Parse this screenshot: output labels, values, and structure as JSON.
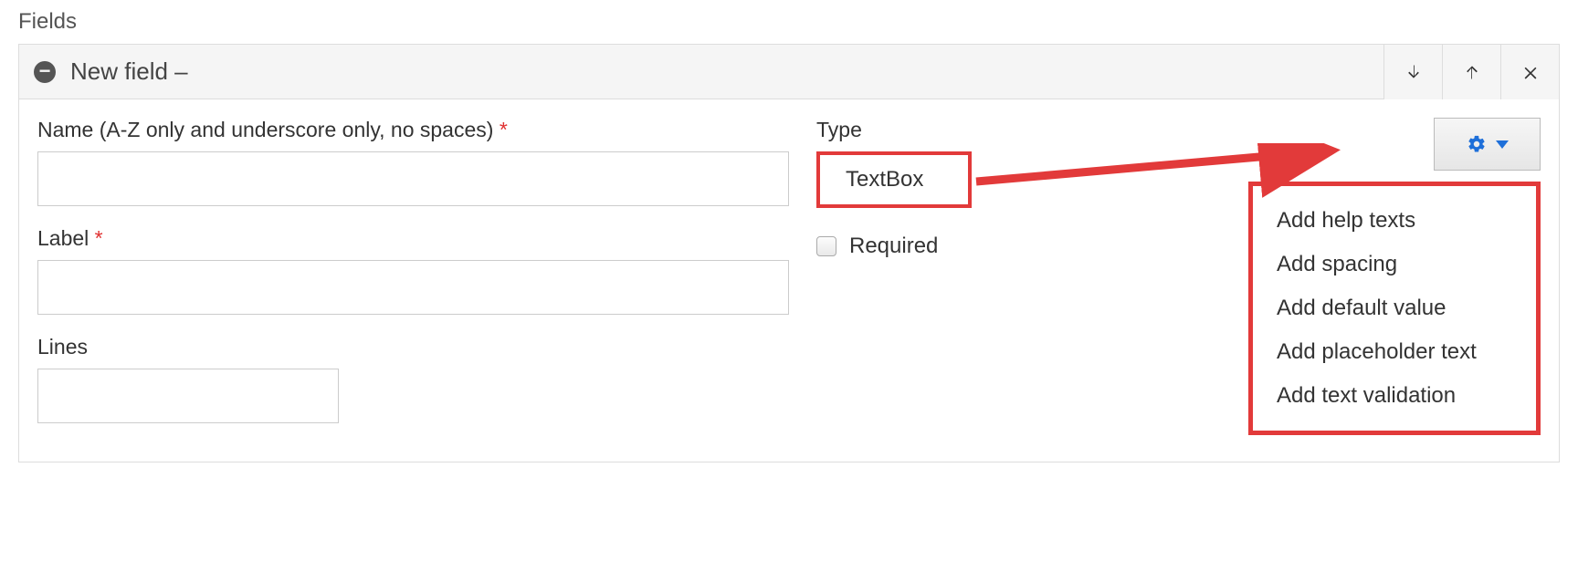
{
  "section_title": "Fields",
  "panel": {
    "title": "New field –"
  },
  "form": {
    "name_label": "Name (A-Z only and underscore only, no spaces)",
    "name_value": "",
    "label_label": "Label",
    "label_value": "",
    "lines_label": "Lines",
    "lines_value": "",
    "type_label": "Type",
    "type_value": "TextBox",
    "required_label": "Required",
    "required_checked": false
  },
  "dropdown": {
    "items": [
      "Add help texts",
      "Add spacing",
      "Add default value",
      "Add placeholder text",
      "Add text validation"
    ]
  }
}
